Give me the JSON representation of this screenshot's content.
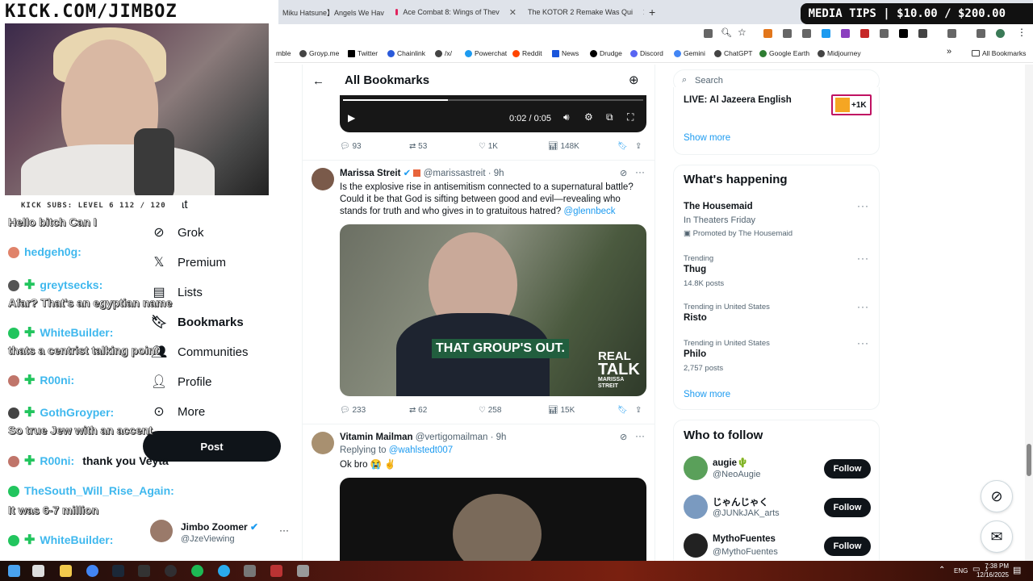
{
  "overlay": {
    "logo_text": "KICK.COM/JIMBOZ",
    "media_tips": "MEDIA TIPS | $10.00 / $200.00",
    "subs_text": "KICK SUBS: LEVEL 6 112 / 120",
    "chat": [
      {
        "name": "",
        "msg": "Hello bitch Can I"
      },
      {
        "name": "hedgeh0g:",
        "msg": ""
      },
      {
        "name": "greytsecks:",
        "msg": "Afar? That's an egyptian name"
      },
      {
        "name": "WhiteBuilder:",
        "msg": "thats a centrist talking point"
      },
      {
        "name": "R00ni:",
        "msg": ""
      },
      {
        "name": "GothGroyper:",
        "msg": "So true Jew with an accent"
      },
      {
        "name": "R00ni:",
        "msg": "thank you Veyta"
      },
      {
        "name": "TheSouth_Will_Rise_Again:",
        "msg": "It was 6-7 million"
      },
      {
        "name": "WhiteBuilder:",
        "msg": ""
      }
    ]
  },
  "browser": {
    "tabs": [
      {
        "label": "Miku Hatsune】Angels We Hav"
      },
      {
        "label": "Ace Combat 8: Wings of Thev"
      },
      {
        "label": "The KOTOR 2 Remake Was Qui"
      }
    ],
    "new_tab": "+",
    "bookmarks": [
      "mble",
      "Groyp.me",
      "Twitter",
      "Chainlink",
      "/x/",
      "Powerchat",
      "Reddit",
      "News",
      "Drudge",
      "Discord",
      "Gemini",
      "ChatGPT",
      "Google Earth",
      "Midjourney"
    ],
    "all_bookmarks": "All Bookmarks",
    "more_bookmarks": "»"
  },
  "nav": {
    "partial_item": "at",
    "items": [
      {
        "icon": "grok-icon",
        "label": "Grok"
      },
      {
        "icon": "x-logo-icon",
        "label": "Premium"
      },
      {
        "icon": "list-icon",
        "label": "Lists"
      },
      {
        "icon": "bookmark-icon",
        "label": "Bookmarks"
      },
      {
        "icon": "communities-icon",
        "label": "Communities"
      },
      {
        "icon": "profile-icon",
        "label": "Profile"
      },
      {
        "icon": "more-icon",
        "label": "More"
      }
    ],
    "post_label": "Post",
    "account": {
      "name": "Jimbo Zoomer",
      "handle": "@JzeViewing"
    }
  },
  "main": {
    "title": "All Bookmarks",
    "video_time": "0:02 / 0:05",
    "tweet0_actions": {
      "replies": "93",
      "reposts": "53",
      "likes": "1K",
      "views": "148K"
    },
    "tweet1": {
      "name": "Marissa Streit",
      "handle": "@marissastreit",
      "time": "· 9h",
      "text": "Is the explosive rise in antisemitism connected to a supernatural battle? Could it be that God is sifting between good and evil—revealing who stands for truth and who gives in to gratuitous hatred?",
      "mention": "@glennbeck",
      "caption": "THAT GROUP'S OUT.",
      "watermark1": "REAL",
      "watermark2": "TALK",
      "watermark3": "MARISSA STREIT",
      "actions": {
        "replies": "233",
        "reposts": "62",
        "likes": "258",
        "views": "15K"
      }
    },
    "tweet2": {
      "name": "Vitamin Mailman",
      "handle": "@vertigomailman",
      "time": "· 9h",
      "replying_prefix": "Replying to",
      "replying_to": "@wahlstedt007",
      "text": "Ok bro 😭 ✌"
    }
  },
  "sidebar": {
    "search_placeholder": "Search",
    "live": {
      "title": "LIVE: Al Jazeera English",
      "badge": "+1K",
      "show_more": "Show more"
    },
    "happening": {
      "title": "What's happening",
      "items": [
        {
          "category": "",
          "title": "The Housemaid",
          "sub": "In Theaters Friday",
          "promo": "Promoted by The Housemaid"
        },
        {
          "category": "Trending",
          "title": "Thug",
          "sub": "14.8K posts"
        },
        {
          "category": "Trending in United States",
          "title": "Risto",
          "sub": ""
        },
        {
          "category": "Trending in United States",
          "title": "Philo",
          "sub": "2,757 posts"
        }
      ],
      "show_more": "Show more"
    },
    "who_to_follow": {
      "title": "Who to follow",
      "follow_label": "Follow",
      "users": [
        {
          "name": "augie🌵",
          "handle": "@NeoAugie"
        },
        {
          "name": "じゃんじゃく",
          "handle": "@JUNkJAK_arts"
        },
        {
          "name": "MythoFuentes",
          "handle": "@MythoFuentes"
        }
      ]
    }
  },
  "taskbar": {
    "lang": "ENG",
    "time": "7:38 PM",
    "date": "12/16/2025"
  }
}
